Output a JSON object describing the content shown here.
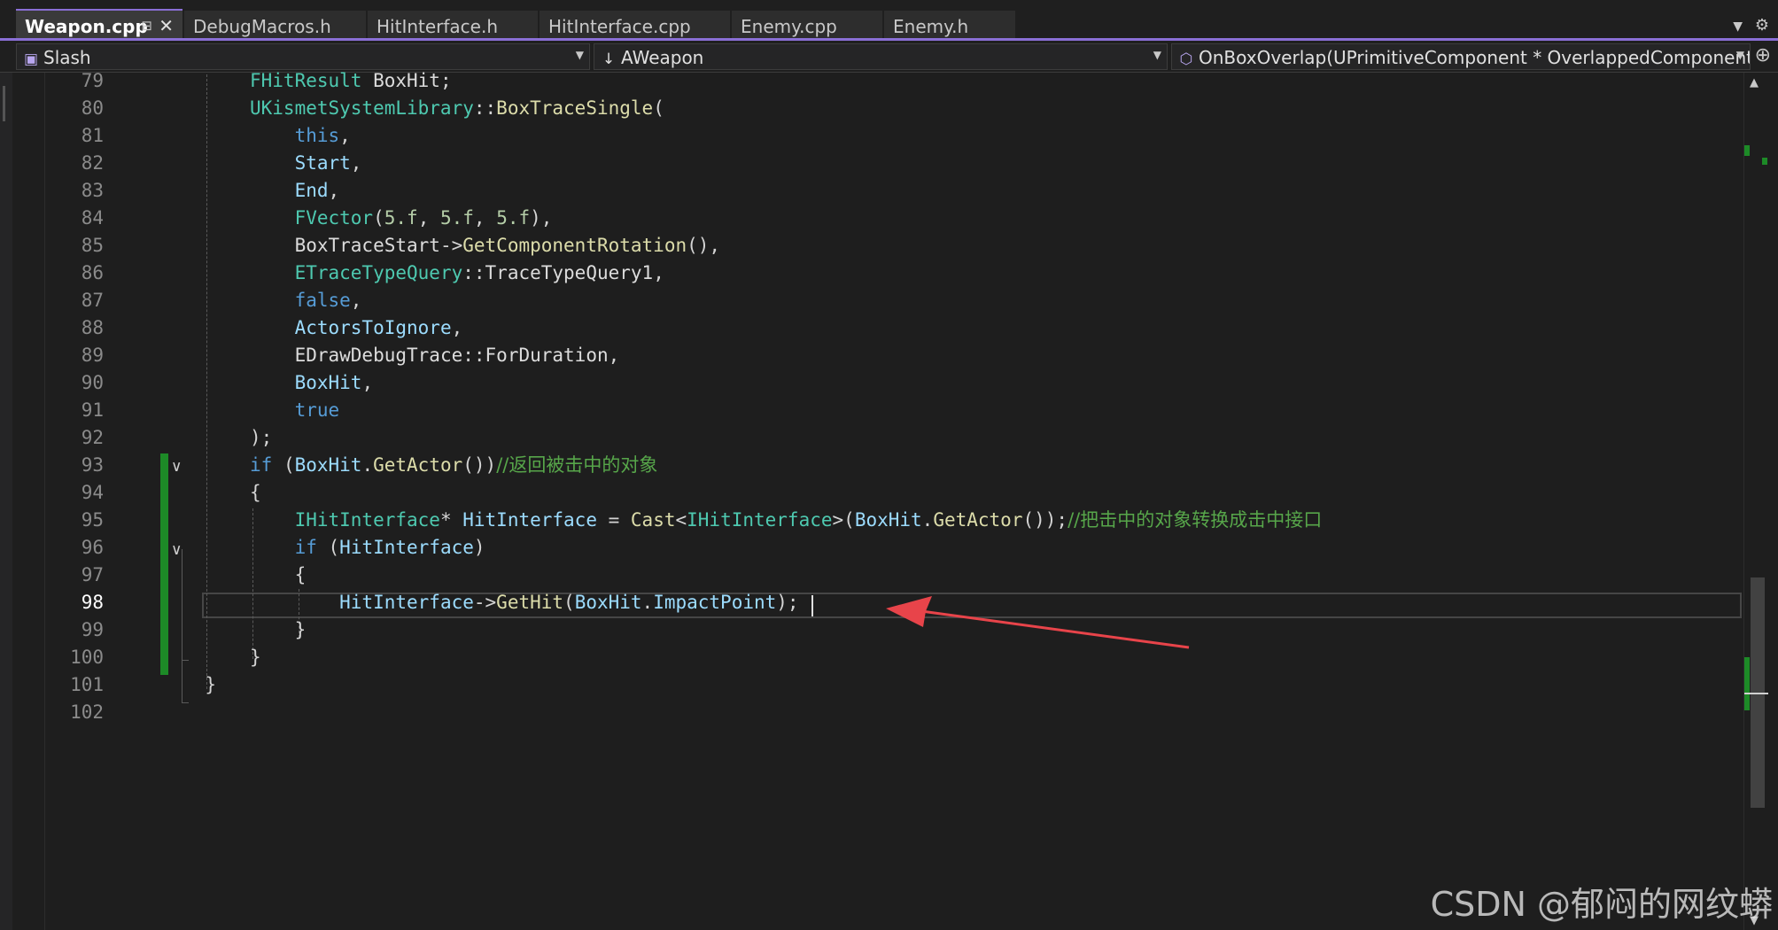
{
  "tabs": [
    {
      "label": "Weapon.cpp",
      "active": true
    },
    {
      "label": "DebugMacros.h"
    },
    {
      "label": "HitInterface.h"
    },
    {
      "label": "HitInterface.cpp"
    },
    {
      "label": "Enemy.cpp"
    },
    {
      "label": "Enemy.h"
    }
  ],
  "tab_icons": {
    "pin": "pin-icon",
    "close": "close-icon",
    "overflow": "chevron-down-icon",
    "settings": "gear-icon"
  },
  "navbar": {
    "project": "Slash",
    "class_scope": "AWeapon",
    "member": "OnBoxOverlap(UPrimitiveComponent * OverlappedComponent, AAct"
  },
  "editor": {
    "line_numbers": [
      "79",
      "80",
      "81",
      "82",
      "83",
      "84",
      "85",
      "86",
      "87",
      "88",
      "89",
      "90",
      "91",
      "92",
      "93",
      "94",
      "95",
      "96",
      "97",
      "98",
      "99",
      "100",
      "101",
      "102"
    ],
    "current_line": "98",
    "lines": [
      [
        [
          "t",
          "FHitResult"
        ],
        [
          "w",
          " BoxHit"
        ],
        [
          "p",
          ";"
        ]
      ],
      [
        [
          "t",
          "UKismetSystemLibrary"
        ],
        [
          "p",
          "::"
        ],
        [
          "f",
          "BoxTraceSingle"
        ],
        [
          "p",
          "("
        ]
      ],
      [
        [
          "p",
          "    "
        ],
        [
          "k",
          "this"
        ],
        [
          "p",
          ","
        ]
      ],
      [
        [
          "p",
          "    "
        ],
        [
          "v",
          "Start"
        ],
        [
          "p",
          ","
        ]
      ],
      [
        [
          "p",
          "    "
        ],
        [
          "v",
          "End"
        ],
        [
          "p",
          ","
        ]
      ],
      [
        [
          "p",
          "    "
        ],
        [
          "t",
          "FVector"
        ],
        [
          "p",
          "("
        ],
        [
          "n",
          "5.f"
        ],
        [
          "p",
          ", "
        ],
        [
          "n",
          "5.f"
        ],
        [
          "p",
          ", "
        ],
        [
          "n",
          "5.f"
        ],
        [
          "p",
          "),"
        ]
      ],
      [
        [
          "p",
          "    "
        ],
        [
          "w",
          "BoxTraceStart"
        ],
        [
          "p",
          "->"
        ],
        [
          "f",
          "GetComponentRotation"
        ],
        [
          "p",
          "(),"
        ]
      ],
      [
        [
          "p",
          "    "
        ],
        [
          "t",
          "ETraceTypeQuery"
        ],
        [
          "p",
          "::"
        ],
        [
          "w",
          "TraceTypeQuery1"
        ],
        [
          "p",
          ","
        ]
      ],
      [
        [
          "p",
          "    "
        ],
        [
          "k",
          "false"
        ],
        [
          "p",
          ","
        ]
      ],
      [
        [
          "p",
          "    "
        ],
        [
          "v",
          "ActorsToIgnore"
        ],
        [
          "p",
          ","
        ]
      ],
      [
        [
          "p",
          "    "
        ],
        [
          "w",
          "EDrawDebugTrace"
        ],
        [
          "p",
          "::"
        ],
        [
          "w",
          "ForDuration"
        ],
        [
          "p",
          ","
        ]
      ],
      [
        [
          "p",
          "    "
        ],
        [
          "v",
          "BoxHit"
        ],
        [
          "p",
          ","
        ]
      ],
      [
        [
          "p",
          "    "
        ],
        [
          "k",
          "true"
        ]
      ],
      [
        [
          "p",
          ");"
        ]
      ],
      [
        [
          "k",
          "if"
        ],
        [
          "p",
          " ("
        ],
        [
          "v",
          "BoxHit"
        ],
        [
          "p",
          "."
        ],
        [
          "f",
          "GetActor"
        ],
        [
          "p",
          "())"
        ],
        [
          "c",
          "//返回被击中的对象"
        ]
      ],
      [
        [
          "p",
          "{"
        ]
      ],
      [
        [
          "p",
          "    "
        ],
        [
          "t",
          "IHitInterface"
        ],
        [
          "p",
          "* "
        ],
        [
          "v",
          "HitInterface"
        ],
        [
          "p",
          " = "
        ],
        [
          "f",
          "Cast"
        ],
        [
          "p",
          "<"
        ],
        [
          "t",
          "IHitInterface"
        ],
        [
          "p",
          ">("
        ],
        [
          "v",
          "BoxHit"
        ],
        [
          "p",
          "."
        ],
        [
          "f",
          "GetActor"
        ],
        [
          "p",
          "());"
        ],
        [
          "c",
          "//把击中的对象转换成击中接口"
        ]
      ],
      [
        [
          "p",
          "    "
        ],
        [
          "k",
          "if"
        ],
        [
          "p",
          " ("
        ],
        [
          "v",
          "HitInterface"
        ],
        [
          "p",
          ")"
        ]
      ],
      [
        [
          "p",
          "    {"
        ]
      ],
      [
        [
          "p",
          "        "
        ],
        [
          "v",
          "HitInterface"
        ],
        [
          "p",
          "->"
        ],
        [
          "f",
          "GetHit"
        ],
        [
          "p",
          "("
        ],
        [
          "v",
          "BoxHit"
        ],
        [
          "p",
          "."
        ],
        [
          "v",
          "ImpactPoint"
        ],
        [
          "p",
          ");"
        ]
      ],
      [
        [
          "p",
          "    }"
        ]
      ],
      [
        [
          "p",
          "}"
        ]
      ],
      [
        [
          "p",
          "}"
        ]
      ],
      [
        [
          "p",
          ""
        ]
      ]
    ],
    "line_indent_cols": [
      0,
      0,
      0,
      0,
      0,
      0,
      0,
      0,
      0,
      0,
      0,
      0,
      0,
      0,
      0,
      0,
      0,
      0,
      0,
      0,
      0,
      0,
      -1,
      0
    ]
  },
  "watermark": "CSDN @郁闷的网纹蟒",
  "colors": {
    "type": "#4ec9b0",
    "variable": "#9cdcfe",
    "function": "#dcdcaa",
    "keyword": "#569cd6",
    "number": "#b5cea8",
    "comment": "#57a64a",
    "accent": "#8a6fd6",
    "change_bar": "#1d8a27",
    "annotation_arrow": "#e8444a"
  }
}
